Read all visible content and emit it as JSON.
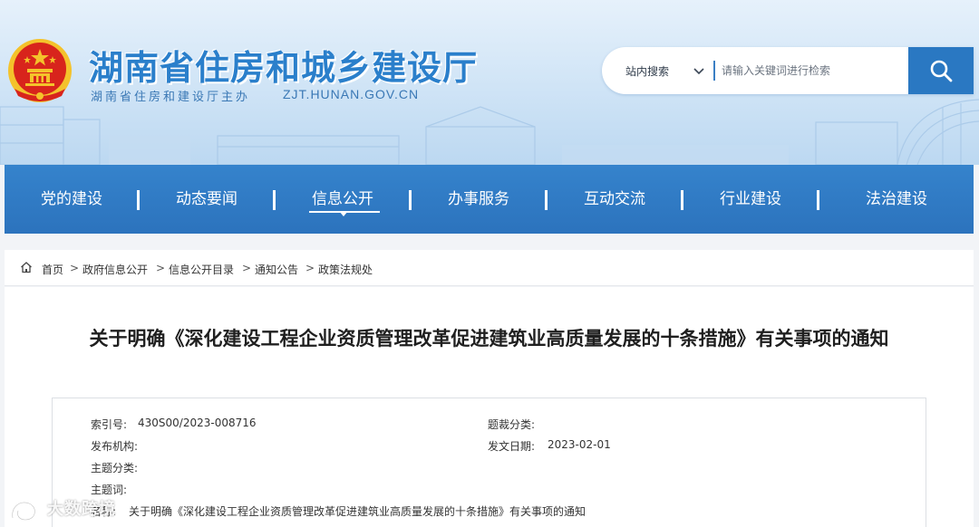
{
  "header": {
    "title": "湖南省住房和城乡建设厅",
    "subtitle": "湖南省住房和建设厅主办",
    "domain": "ZJT.HUNAN.GOV.CN"
  },
  "search": {
    "scope": "站内搜索",
    "placeholder": "请输入关键词进行检索"
  },
  "nav": {
    "items": [
      "党的建设",
      "动态要闻",
      "信息公开",
      "办事服务",
      "互动交流",
      "行业建设",
      "法治建设"
    ],
    "active": "信息公开"
  },
  "breadcrumb": [
    "首页",
    "政府信息公开",
    "信息公开目录",
    "通知公告",
    "政策法规处"
  ],
  "article": {
    "title": "关于明确《深化建设工程企业资质管理改革促进建筑业高质量发展的十条措施》有关事项的通知",
    "meta": {
      "index_label": "索引号:",
      "index_value": "430S00/2023-008716",
      "category_label": "题裁分类:",
      "category_value": "",
      "publisher_label": "发布机构:",
      "publisher_value": "",
      "date_label": "发文日期:",
      "date_value": "2023-02-01",
      "topic_label": "主题分类:",
      "topic_value": "",
      "keywords_label": "主题词:",
      "keywords_value": "",
      "name_label": "名称:",
      "name_value": "关于明确《深化建设工程企业资质管理改革促进建筑业高质量发展的十条措施》有关事项的通知"
    }
  },
  "watermark": {
    "text": "大数跨境"
  },
  "colors": {
    "brand_blue": "#2a78c2",
    "nav_blue": "#2f77c1",
    "title_blue": "#2a7fcb",
    "emblem_red": "#d8241c",
    "emblem_gold": "#f4c22b"
  },
  "icons": {
    "emblem": "national-emblem",
    "search": "search-icon",
    "home": "home-icon",
    "chevron": "chevron-down-icon"
  }
}
